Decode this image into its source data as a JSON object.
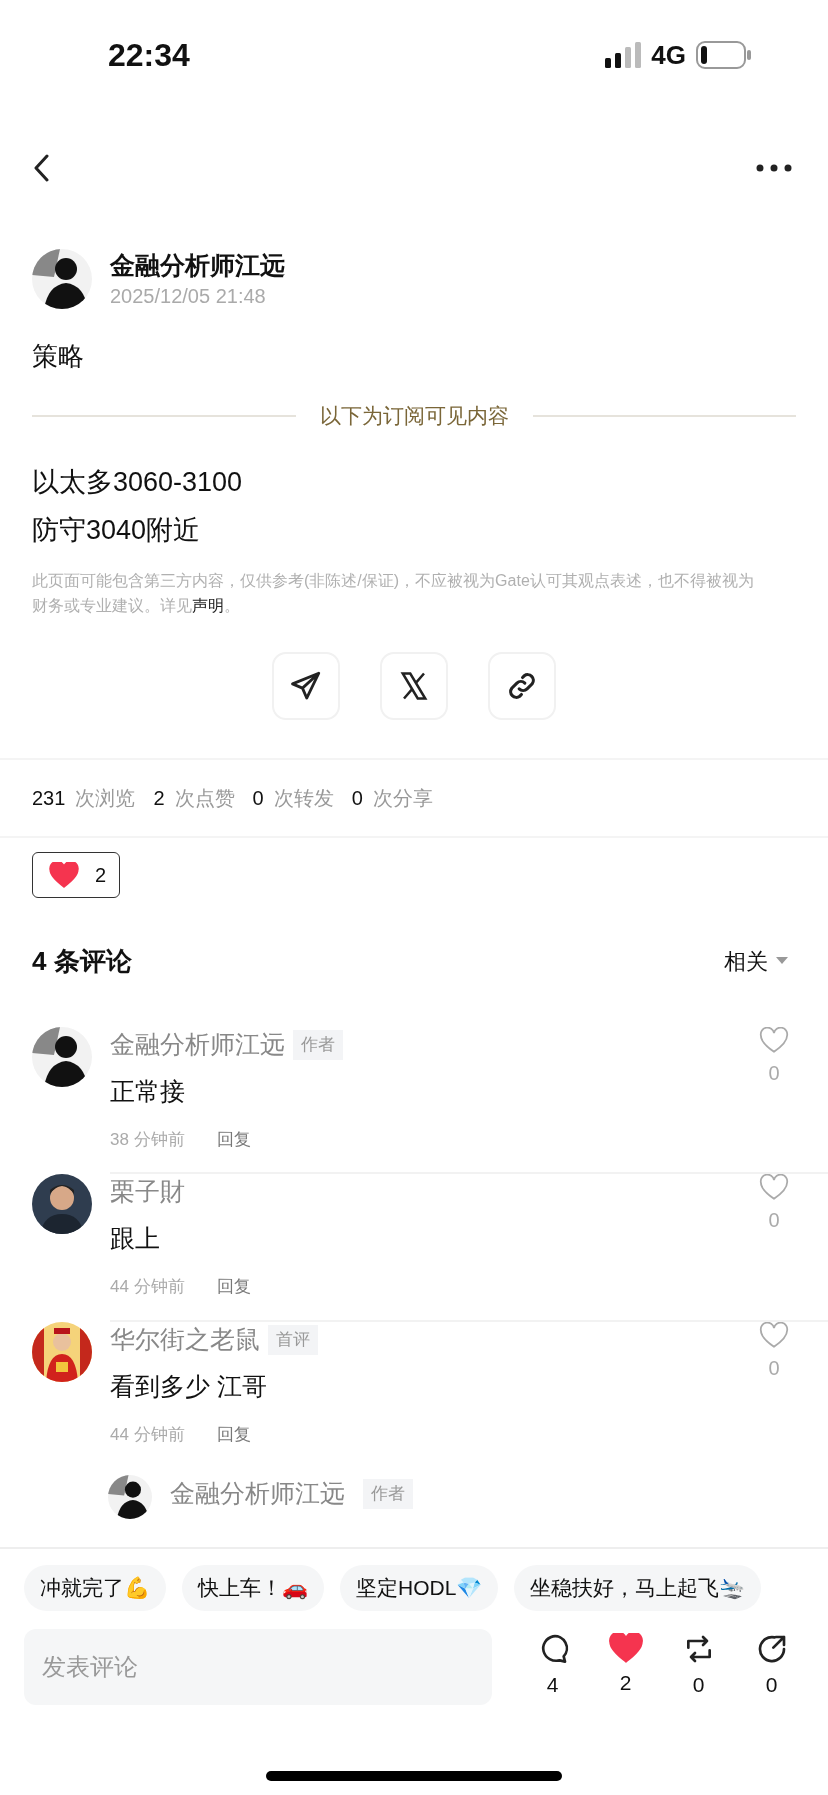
{
  "status_bar": {
    "time": "22:34",
    "network": "4G"
  },
  "post": {
    "author": "金融分析师江远",
    "time": "2025/12/05 21:48",
    "title": "策略",
    "divider_label": "以下为订阅可见内容",
    "content_lines": [
      "以太多3060-3100",
      "防守3040附近"
    ],
    "disclaimer": {
      "text": "此页面可能包含第三方内容，仅供参考(非陈述/保证)，不应被视为Gate认可其观点表述，也不得被视为财务或专业建议。详见",
      "link": "声明",
      "end": "。"
    }
  },
  "share_buttons": [
    {
      "kind": "telegram"
    },
    {
      "kind": "x"
    },
    {
      "kind": "link"
    }
  ],
  "stats": [
    {
      "count": "231",
      "label": "次浏览"
    },
    {
      "count": "2",
      "label": "次点赞"
    },
    {
      "count": "0",
      "label": "次转发"
    },
    {
      "count": "0",
      "label": "次分享"
    }
  ],
  "reaction": {
    "count": "2",
    "liked": true
  },
  "comments_header": {
    "title": "4 条评论",
    "sort": "相关"
  },
  "comments": [
    {
      "author": "金融分析师江远",
      "badge": "作者",
      "text": "正常接",
      "time": "38 分钟前",
      "reply": "回复",
      "likes": "0",
      "liked": false
    },
    {
      "author": "栗子財",
      "text": "跟上",
      "time": "44 分钟前",
      "reply": "回复",
      "likes": "0",
      "liked": false
    },
    {
      "author": "华尔街之老鼠",
      "badge": "首评",
      "text": "看到多少 江哥",
      "time": "44 分钟前",
      "reply": "回复",
      "likes": "0",
      "liked": false
    }
  ],
  "partial_reply": {
    "author": "金融分析师江远",
    "badge": "作者"
  },
  "quick_replies": [
    "冲就完了💪",
    "快上车！🚗",
    "坚定HODL💎",
    "坐稳扶好，马上起飞🛬"
  ],
  "composer": {
    "placeholder": "发表评论"
  },
  "actions": [
    {
      "kind": "comment",
      "count": "4",
      "active": false
    },
    {
      "kind": "like",
      "count": "2",
      "active": true
    },
    {
      "kind": "repost",
      "count": "0",
      "active": false
    },
    {
      "kind": "share",
      "count": "0",
      "active": false
    }
  ]
}
